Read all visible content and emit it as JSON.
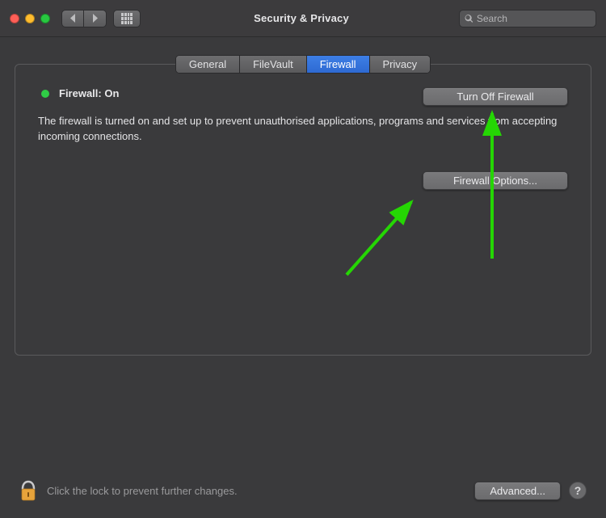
{
  "window": {
    "title": "Security & Privacy",
    "search_placeholder": "Search"
  },
  "tabs": [
    {
      "label": "General",
      "active": false
    },
    {
      "label": "FileVault",
      "active": false
    },
    {
      "label": "Firewall",
      "active": true
    },
    {
      "label": "Privacy",
      "active": false
    }
  ],
  "firewall": {
    "status_label": "Firewall: On",
    "status_color": "#2fcd46",
    "turn_off_label": "Turn Off Firewall",
    "description": "The firewall is turned on and set up to prevent unauthorised applications, programs and services from accepting incoming connections.",
    "options_label": "Firewall Options..."
  },
  "footer": {
    "lock_text": "Click the lock to prevent further changes.",
    "advanced_label": "Advanced...",
    "help_label": "?"
  },
  "annotations": {
    "arrow_color": "#25d604"
  }
}
